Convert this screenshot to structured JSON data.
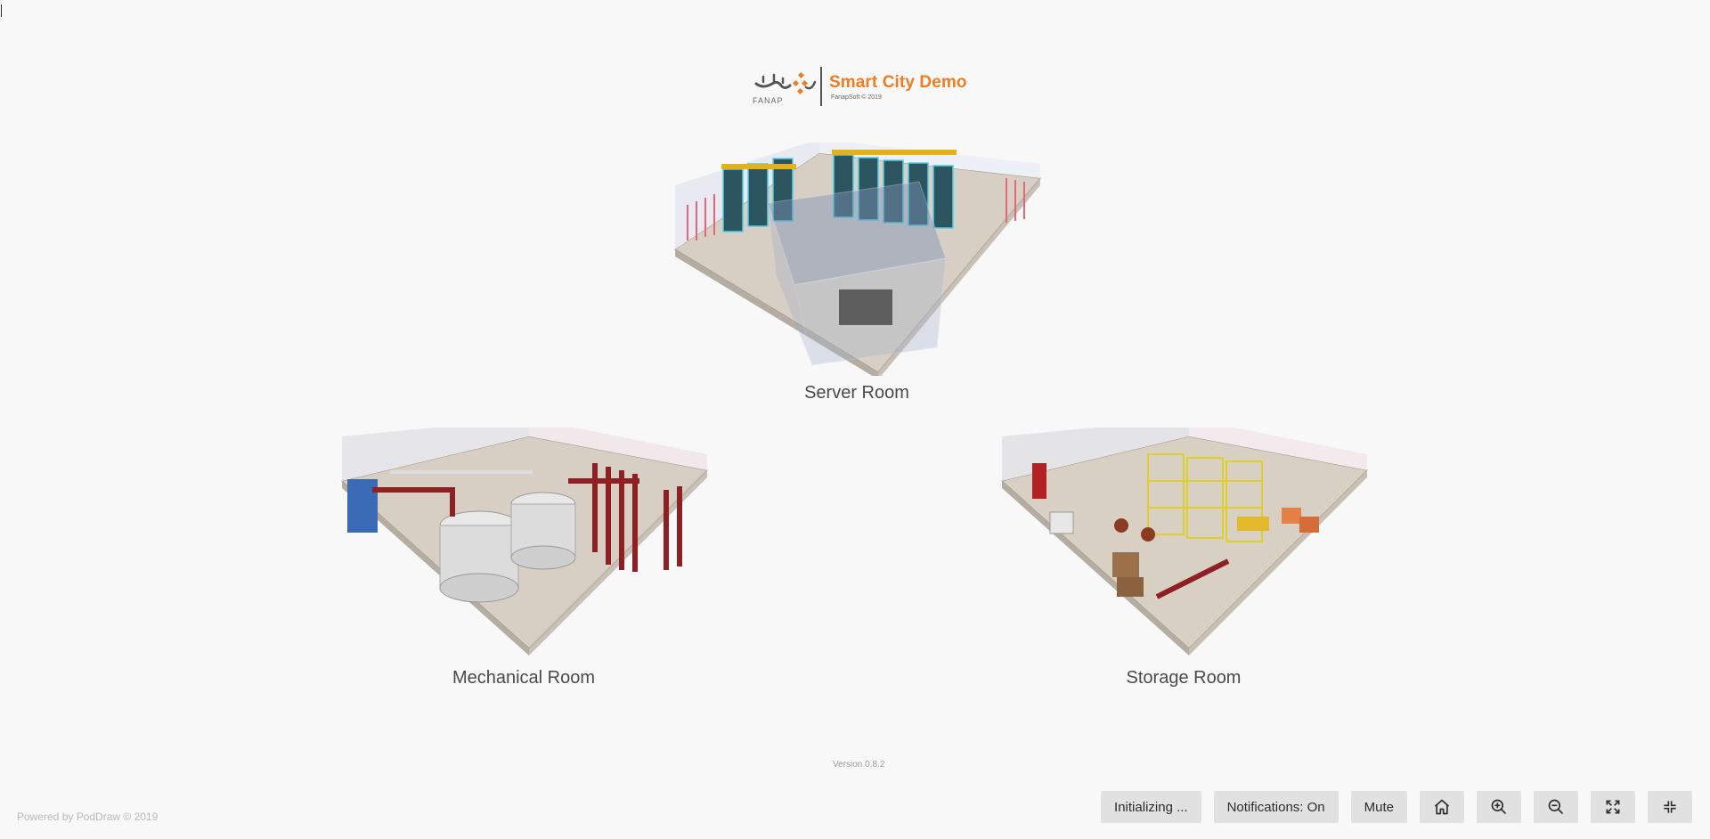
{
  "header": {
    "logo_alt": "FANAP",
    "title": "Smart City Demo",
    "subtitle": "FanapSoft © 2019"
  },
  "rooms": [
    {
      "label": "Server Room"
    },
    {
      "label": "Mechanical Room"
    },
    {
      "label": "Storage Room"
    }
  ],
  "footer": {
    "version": "Version 0.8.2",
    "powered": "Powered by PodDraw © 2019"
  },
  "toolbar": {
    "status_label": "Initializing ...",
    "notifications_label": "Notifications: On",
    "mute_label": "Mute",
    "icons": [
      "home-icon",
      "zoom-in-icon",
      "zoom-out-icon",
      "fullscreen-icon",
      "exit-fullscreen-icon"
    ]
  },
  "colors": {
    "brand": "#ef7d22",
    "background": "#f8f8f8",
    "button_bg": "#e1e1e1"
  }
}
